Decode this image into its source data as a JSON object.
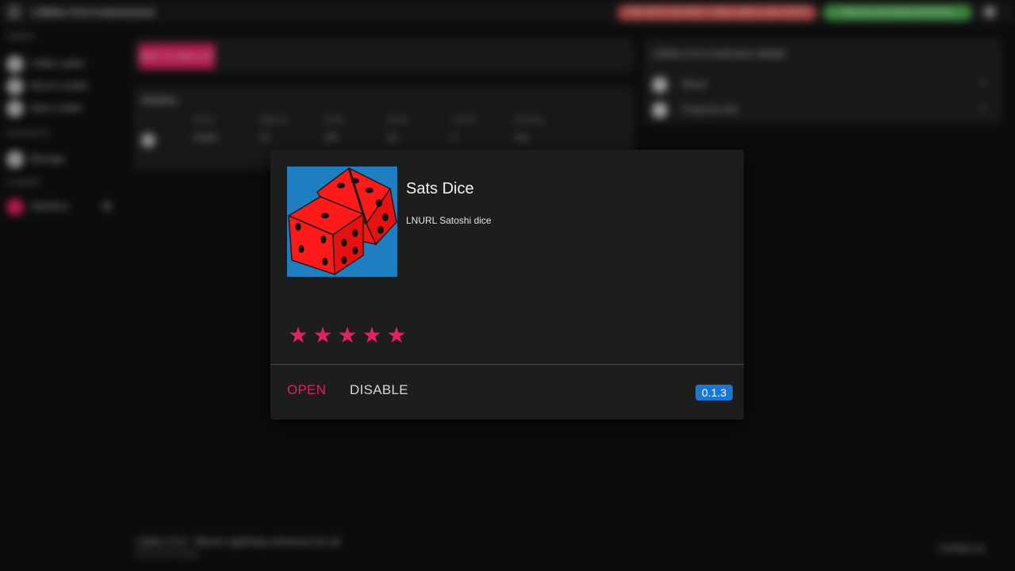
{
  "background": {
    "app_title": "LNbits 0.9.4 extensions",
    "warning_banner": "USE WITH CAUTION - LNbits wallet is still in BETA",
    "ok_banner": "Add your own admin extensions",
    "sidebar": {
      "wallets_heading": "Wallets",
      "wallets": [
        "LNbits wallet",
        "Moon's wallet",
        "Add a wallet"
      ],
      "extensions_heading": "Extensions",
      "extensions": [
        "Manage"
      ],
      "active_heading": "Installed",
      "active": [
        "SatsDice"
      ]
    },
    "create_button": "ADD TO WALLET",
    "wallets_card": {
      "title": "Wallets",
      "headers": [
        "ID",
        "Name",
        "Balance",
        "Status",
        "Admin",
        "Linked",
        "Pending"
      ],
      "row": [
        "Wallet",
        "1k",
        "100",
        "On",
        "0",
        "Yes"
      ]
    },
    "right_card": {
      "title": "LNbits 0.9.4 extension details",
      "items": [
        "About",
        "Featured info"
      ]
    },
    "footer": {
      "text": "LNbits 0.9.4 - Bitcoin Lightning extensions for all",
      "sub": "Extensions listing",
      "right": "Contact us"
    }
  },
  "dialog": {
    "name": "Sats Dice",
    "description": "LNURL Satoshi dice",
    "rating": 5,
    "stars": [
      "★",
      "★",
      "★",
      "★",
      "★"
    ],
    "open_label": "OPEN",
    "disable_label": "DISABLE",
    "version": "0.1.3",
    "image_icon": "dice-icon",
    "colors": {
      "accent": "#e91e63",
      "badge": "#1976d2",
      "image_bg": "#1f7ec2",
      "dice": "#ff1a1a"
    }
  }
}
